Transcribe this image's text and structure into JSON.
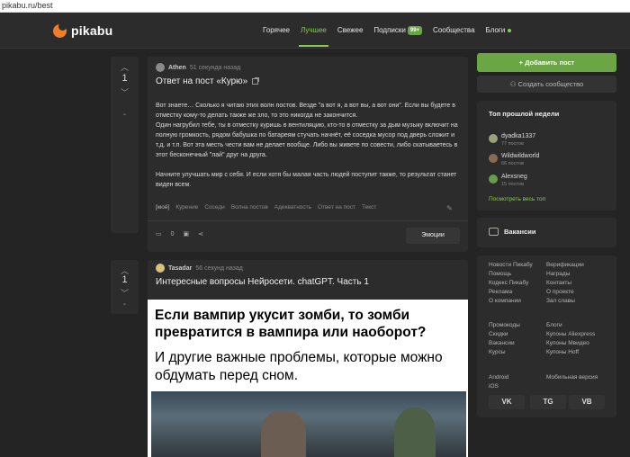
{
  "browser": {
    "url": "pikabu.ru/best"
  },
  "header": {
    "logo": "pikabu",
    "nav": [
      {
        "label": "Горячее"
      },
      {
        "label": "Лучшее"
      },
      {
        "label": "Свежее"
      },
      {
        "label": "Подписки"
      },
      {
        "label": "Сообщества"
      },
      {
        "label": "Блоги"
      }
    ],
    "subscriptions_badge": "99+"
  },
  "post1": {
    "votes": {
      "up": "︿",
      "count": "1",
      "down": "﹀",
      "minus": "-"
    },
    "author": "Athen",
    "time": "51 секунда назад",
    "title": "Ответ на пост «Курю»",
    "para1": "Вот знаете… Сколько я читаю этих волн постов. Везде \"а вот я, а вот вы, а вот они\". Если вы будете в отместку кому-то делать также же зло, то это никогда не закончится.",
    "para2": "Один нагрубил тебе, ты в отместку куришь в вентиляцию, кто-то в отместку за дым музыку включит на полную громкость, рядом бабушка по батареям стучать начнёт, её соседка мусор под дверь сложит и т.д. и т.п. Вот эта месть чести вам не делает вообще. Либо вы живете по совести, либо скатываетесь в этот бесконечный \"лай\" друг на друга.",
    "para3": "Начните улучшать мир с себя. И если хотя бы малая часть людей поступит также, то результат станет виден всем.",
    "tags": [
      "[моё]",
      "Курение",
      "Соседи",
      "Волна постов",
      "Адекватность",
      "Ответ на пост",
      "Текст"
    ],
    "comments": "0",
    "emotions_label": "Эмоции"
  },
  "post2": {
    "votes": {
      "up": "︿",
      "count": "1",
      "down": "﹀",
      "minus": "-"
    },
    "author": "Tasadar",
    "time": "56 секунд назад",
    "title": "Интересные вопросы Нейросети. chatGPT. Часть 1",
    "image_line1": "Если вампир укусит зомби, то зомби превратится в вампира или наоборот?",
    "image_line2": "И другие важные проблемы, которые можно обдумать перед сном."
  },
  "sidebar": {
    "add_post": "Добавить пост",
    "create_community": "Создать сообщество",
    "top_title": "Топ прошлой недели",
    "top": [
      {
        "name": "dyadka1337",
        "posts": "77 постов"
      },
      {
        "name": "Wildwildworld",
        "posts": "66 постов"
      },
      {
        "name": "Alexsneg",
        "posts": "15 постов"
      }
    ],
    "show_all": "Посмотреть весь топ",
    "vacancies": "Вакансии",
    "links_col1": [
      "Новости Пикабу",
      "Помощь",
      "Кодекс Пикабу",
      "Реклама",
      "О компании"
    ],
    "links_col2": [
      "Верификации",
      "Награды",
      "Контакты",
      "О проекте",
      "Зал славы"
    ],
    "links_col3": [
      "Промокоды",
      "Скидки",
      "Вакансии",
      "Курсы"
    ],
    "links_col4": [
      "Блоги",
      "Купоны Aliexpress",
      "Купоны Мвидео",
      "Купоны Hoff"
    ],
    "links_col5": [
      "Android",
      "iOS"
    ],
    "links_col6": [
      "Мобильная версия"
    ],
    "social": [
      "VK",
      "TG",
      "VB"
    ]
  }
}
